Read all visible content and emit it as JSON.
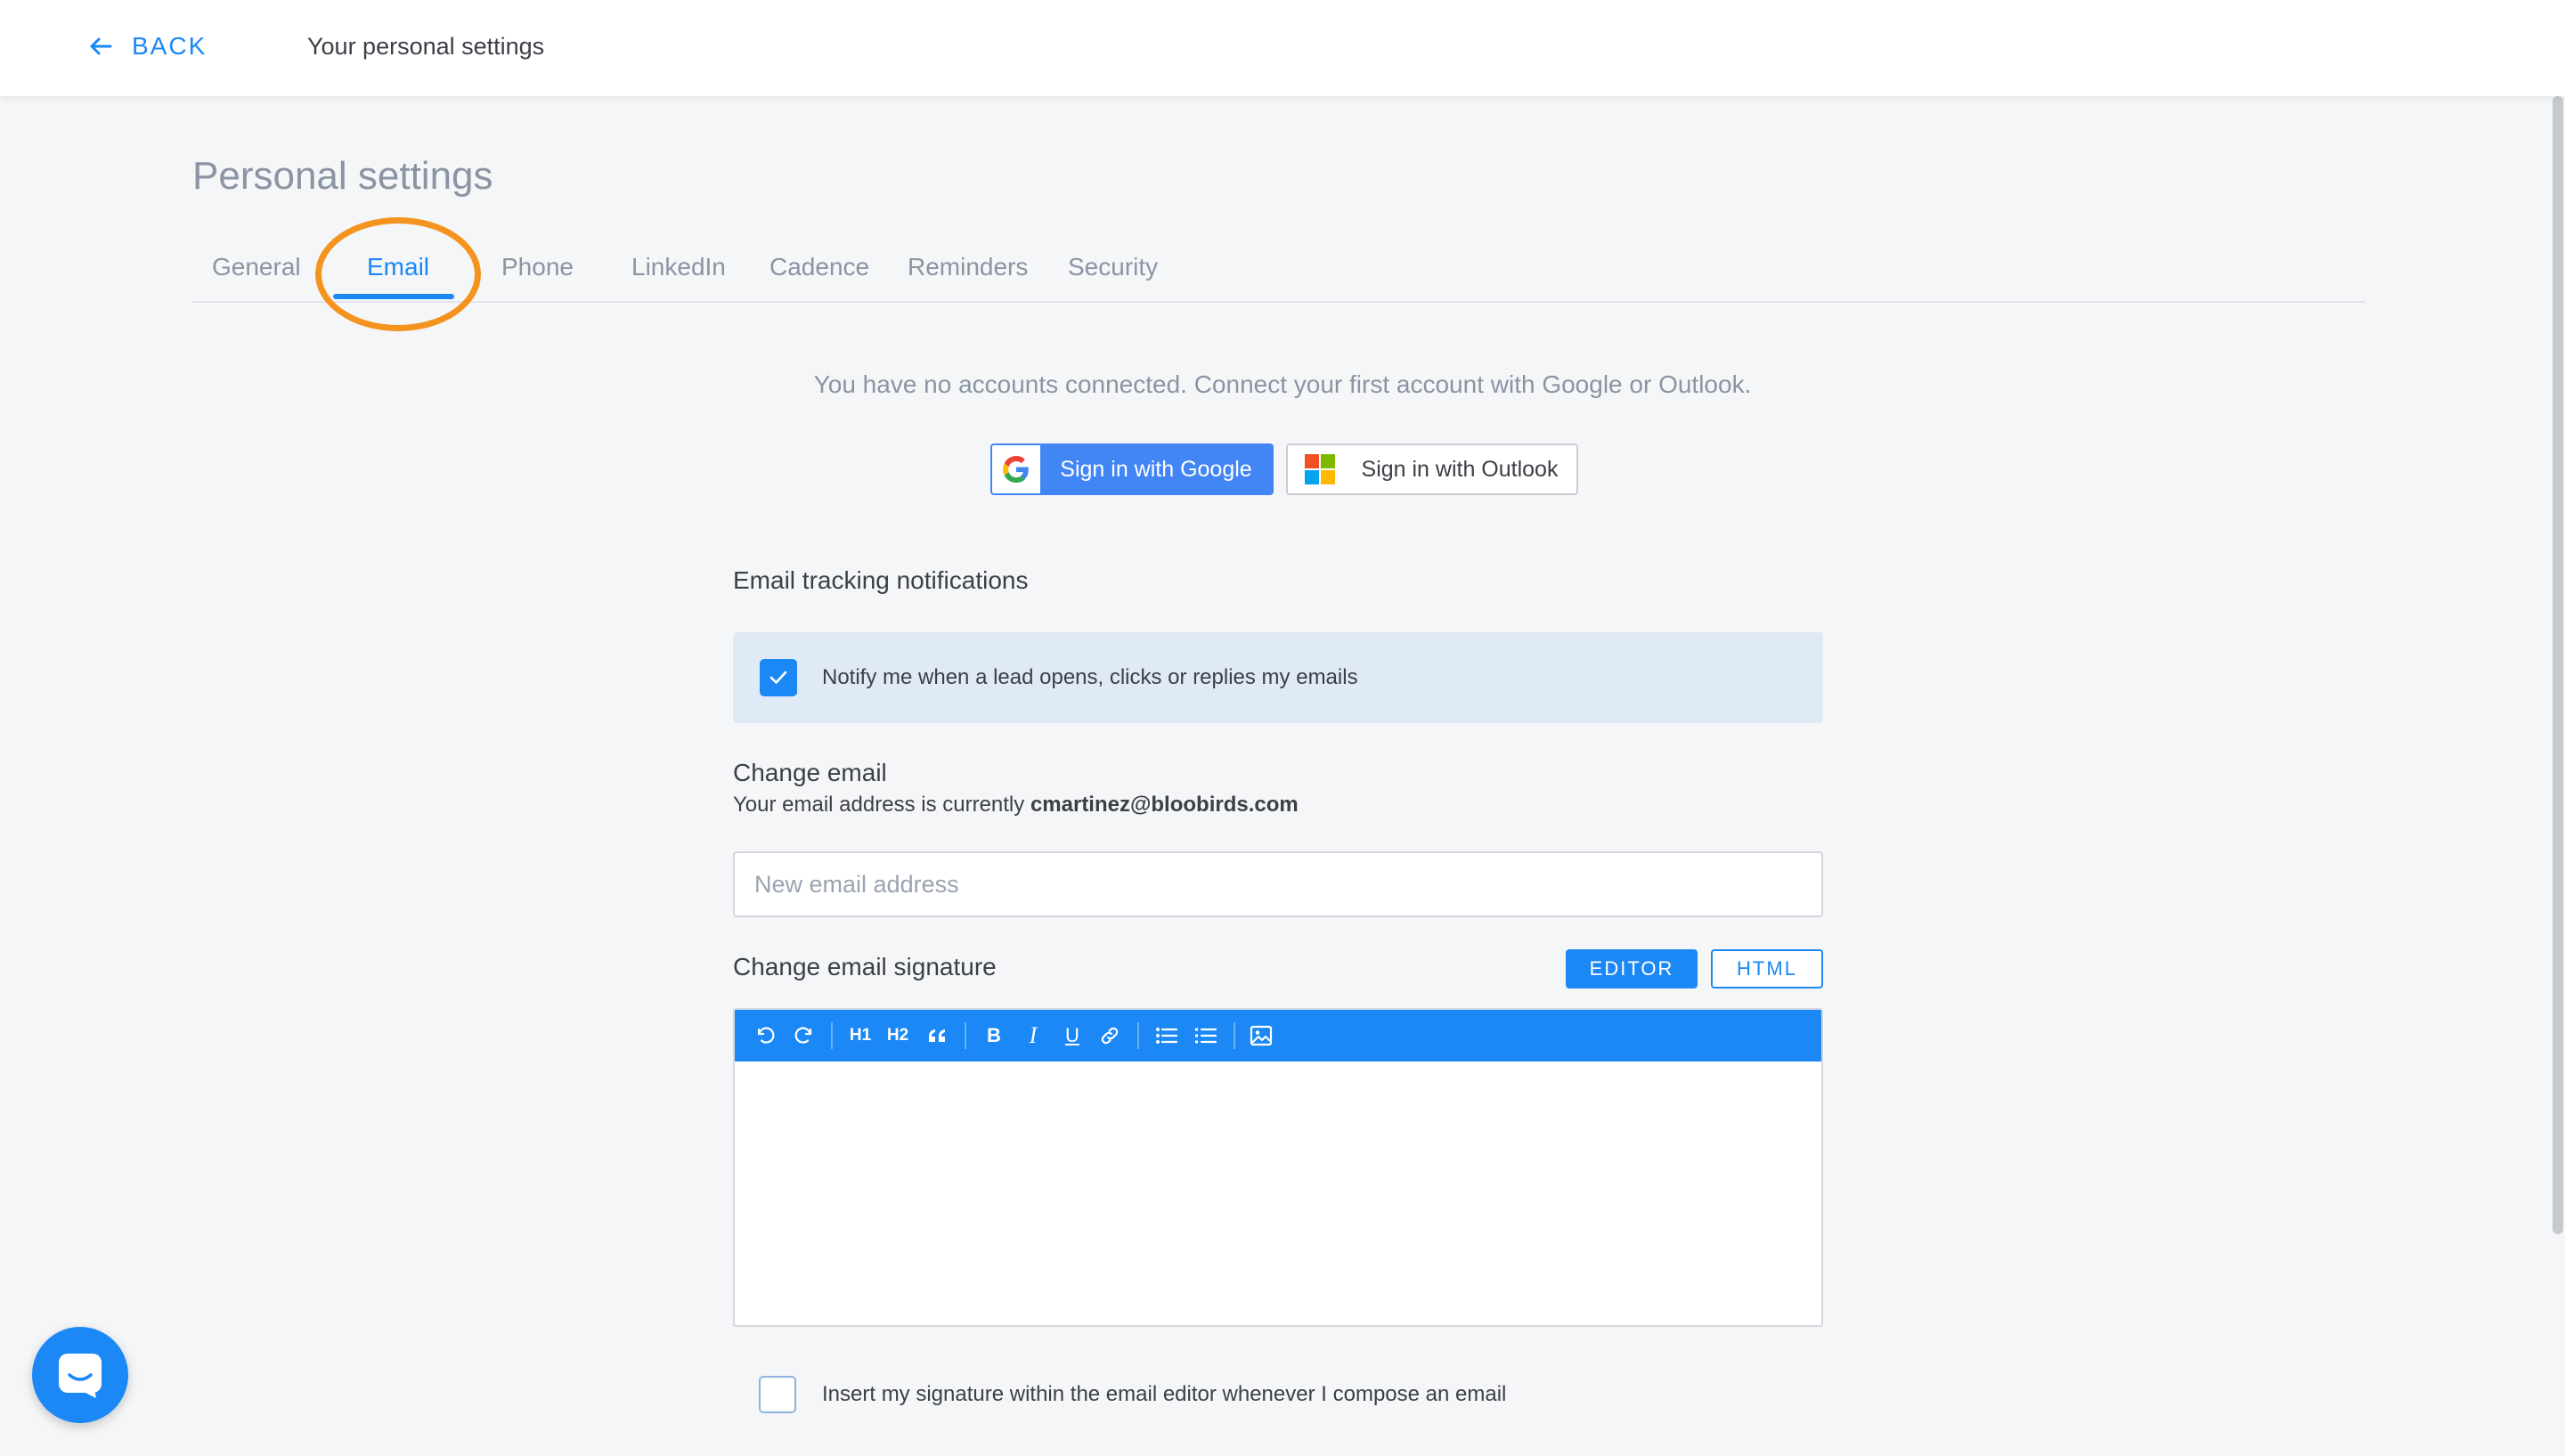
{
  "header": {
    "back_label": "BACK",
    "title": "Your personal settings"
  },
  "page": {
    "title": "Personal settings"
  },
  "tabs": [
    {
      "label": "General",
      "active": false
    },
    {
      "label": "Email",
      "active": true
    },
    {
      "label": "Phone",
      "active": false
    },
    {
      "label": "LinkedIn",
      "active": false
    },
    {
      "label": "Cadence",
      "active": false
    },
    {
      "label": "Reminders",
      "active": false
    },
    {
      "label": "Security",
      "active": false
    }
  ],
  "accounts": {
    "message": "You have no accounts connected. Connect your first account with Google or Outlook.",
    "google_label": "Sign in with Google",
    "outlook_label": "Sign in with Outlook"
  },
  "tracking": {
    "title": "Email tracking notifications",
    "notify_label": "Notify me when a lead opens, clicks or replies my emails",
    "notify_checked": true
  },
  "change_email": {
    "title": "Change email",
    "current_prefix": "Your email address is currently",
    "current_email": "cmartinez@bloobirds.com",
    "input_placeholder": "New email address",
    "input_value": ""
  },
  "signature": {
    "title": "Change email signature",
    "editor_label": "EDITOR",
    "html_label": "HTML",
    "toolbar": [
      "undo-icon",
      "redo-icon",
      "H1",
      "H2",
      "quote-icon",
      "B",
      "I",
      "U",
      "link-icon",
      "bulleted-list-icon",
      "numbered-list-icon",
      "image-icon"
    ],
    "insert_label": "Insert my signature within the email editor whenever I compose an email",
    "insert_checked": false
  },
  "colors": {
    "accent": "#1b88f5",
    "annotation": "#f4931e",
    "google_blue": "#4285f4"
  }
}
